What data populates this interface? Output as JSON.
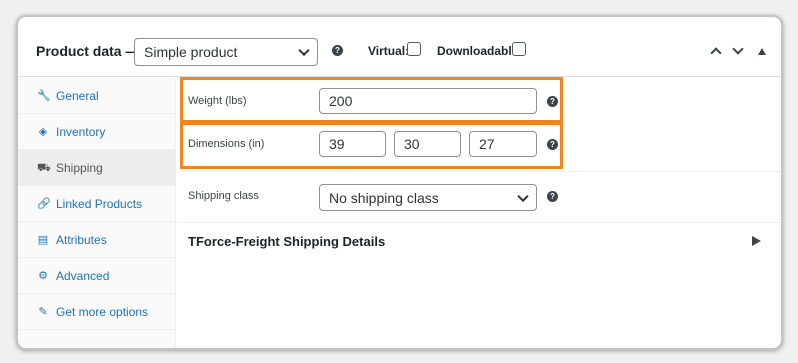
{
  "header": {
    "title": "Product data —",
    "product_type": "Simple product",
    "virtual_label": "Virtual:",
    "downloadable_label": "Downloadable:",
    "help_glyph": "?"
  },
  "sidebar": {
    "items": [
      {
        "label": "General",
        "icon": "wrench-icon",
        "glyph": "🔧"
      },
      {
        "label": "Inventory",
        "icon": "tag-icon",
        "glyph": "◈"
      },
      {
        "label": "Shipping",
        "icon": "truck-icon",
        "glyph": "⛟"
      },
      {
        "label": "Linked Products",
        "icon": "link-icon",
        "glyph": "🔗"
      },
      {
        "label": "Attributes",
        "icon": "list-icon",
        "glyph": "▤"
      },
      {
        "label": "Advanced",
        "icon": "gear-icon",
        "glyph": "⚙"
      },
      {
        "label": "Get more options",
        "icon": "plugin-icon",
        "glyph": "✎"
      }
    ],
    "active_index": 2
  },
  "shipping": {
    "weight_label": "Weight (lbs)",
    "weight_value": "200",
    "dimensions_label": "Dimensions (in)",
    "length": "39",
    "width": "30",
    "height": "27",
    "shipping_class_label": "Shipping class",
    "shipping_class_value": "No shipping class"
  },
  "tforce": {
    "title": "TForce-Freight Shipping Details"
  },
  "colors": {
    "highlight": "#f0861f",
    "link": "#2271b1"
  }
}
